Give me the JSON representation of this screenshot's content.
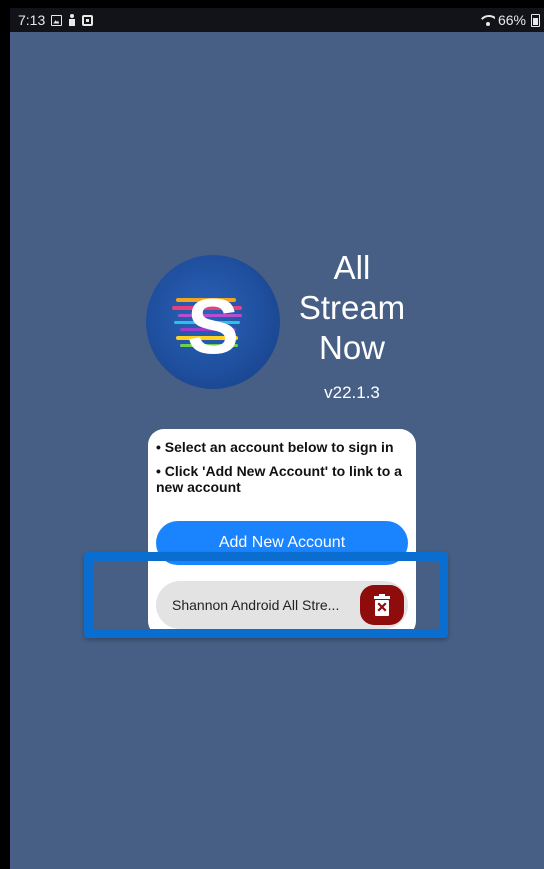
{
  "status_bar": {
    "time": "7:13",
    "battery": "66%",
    "icons": [
      "image-icon",
      "person-icon",
      "box-icon",
      "wifi-icon",
      "battery-icon"
    ]
  },
  "app": {
    "title": "All Stream Now",
    "version": "v22.1.3",
    "logo_letter": "S"
  },
  "card": {
    "instructions": [
      "• Select an account below to sign in",
      "• Click 'Add New Account' to link to a new account"
    ],
    "add_button_label": "Add New Account",
    "accounts": [
      {
        "name": "Shannon Android All Stre..."
      }
    ]
  },
  "colors": {
    "background": "#475f85",
    "primary_button": "#1a84ff",
    "delete_button": "#8e0c0c",
    "highlight": "#0a6ed1"
  }
}
